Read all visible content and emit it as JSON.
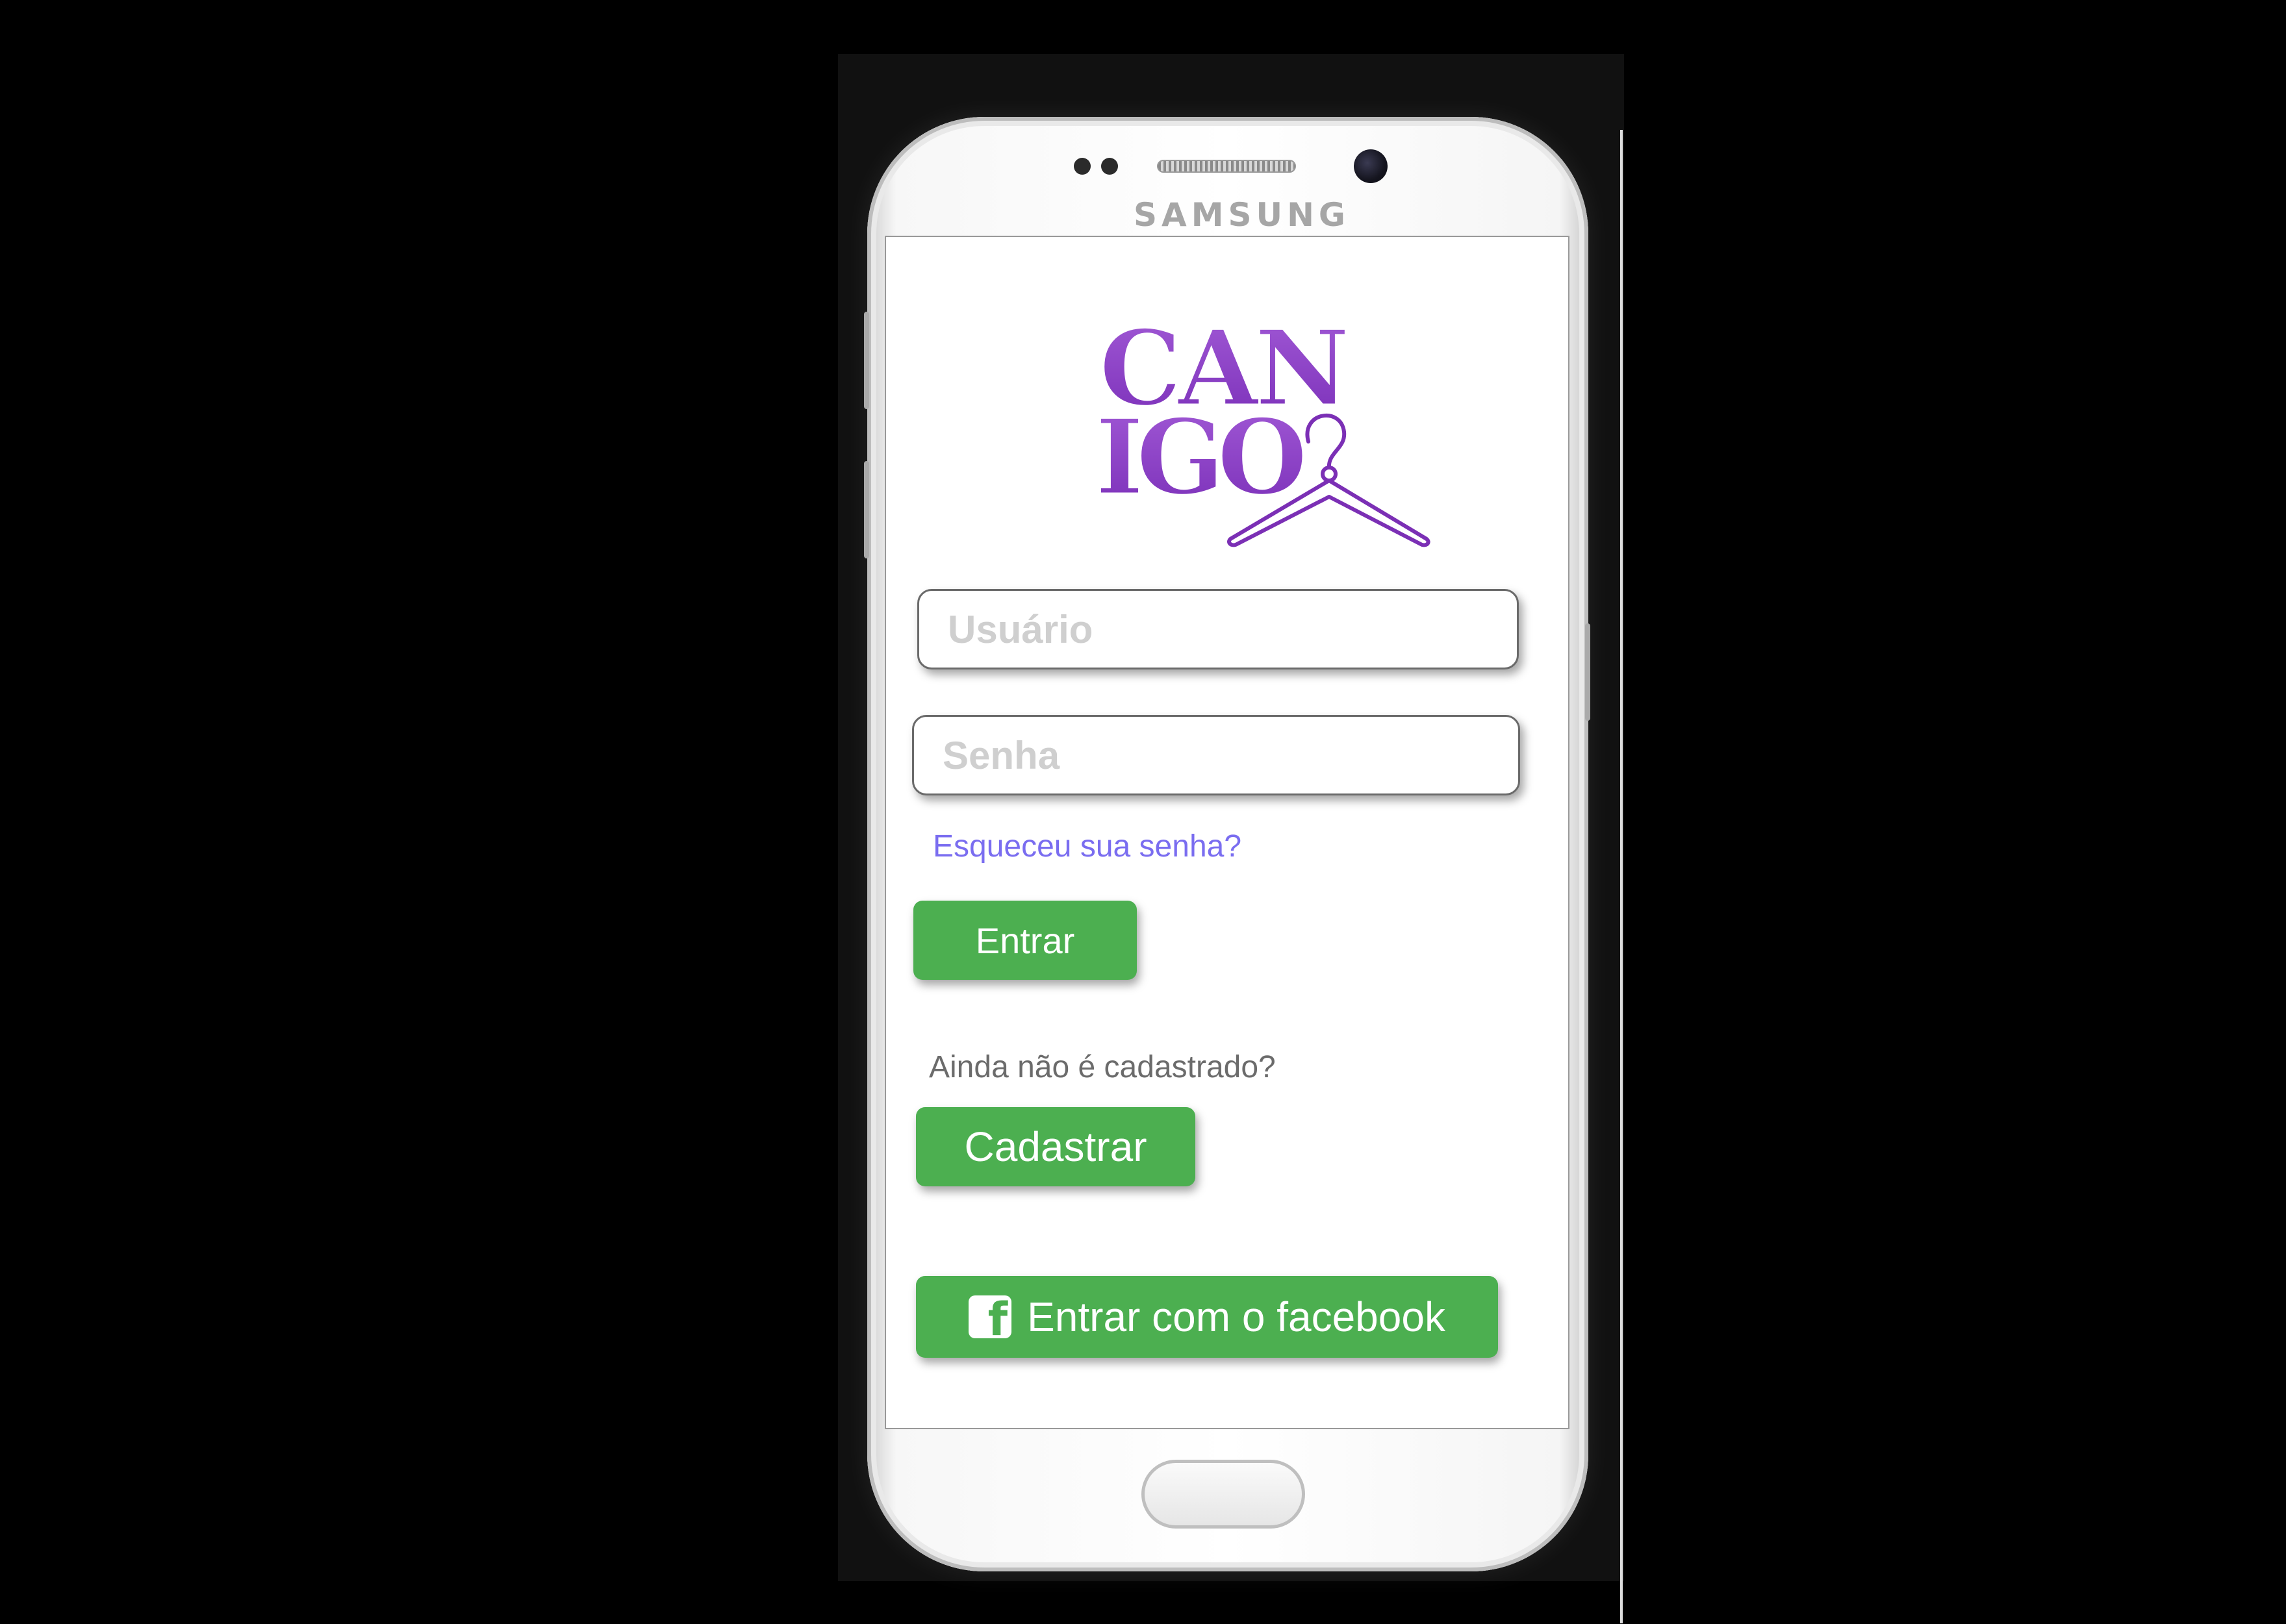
{
  "device": {
    "brand": "SAMSUNG"
  },
  "app": {
    "logo": {
      "line1": "CAN",
      "line2": "IGO",
      "icon": "hanger-icon"
    },
    "username_input": {
      "placeholder": "Usuário",
      "value": ""
    },
    "password_input": {
      "placeholder": "Senha",
      "value": ""
    },
    "forgot_password_link": "Esqueceu sua senha?",
    "login_button": "Entrar",
    "signup_prompt": "Ainda não é cadastrado?",
    "signup_button": "Cadastrar",
    "facebook_button": {
      "label": "Entrar com o facebook",
      "icon": "facebook-icon"
    }
  },
  "colors": {
    "accent_green": "#4caf50",
    "logo_purple": "#8a3fc4",
    "link_color": "#7a6df0"
  }
}
